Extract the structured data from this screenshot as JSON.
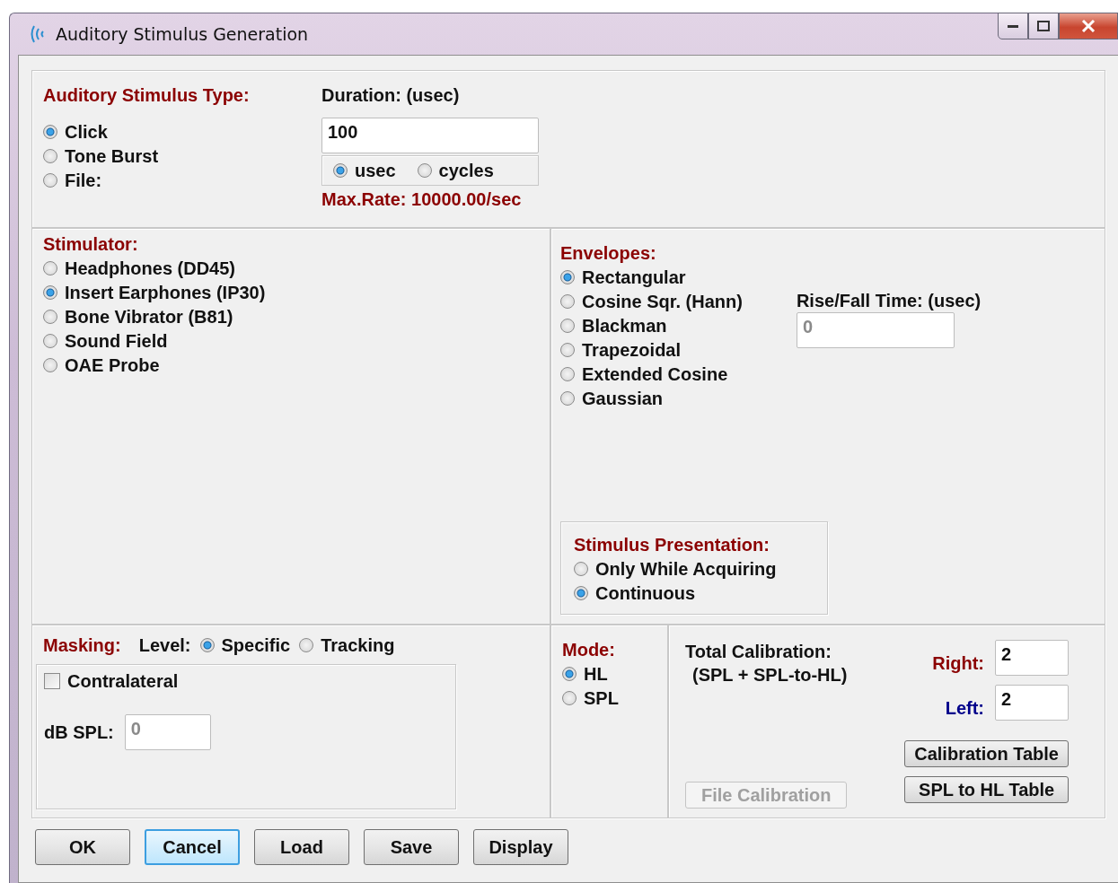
{
  "window": {
    "title": "Auditory Stimulus Generation"
  },
  "stimulus_type": {
    "label": "Auditory Stimulus Type:",
    "options": [
      {
        "label": "Click",
        "selected": true
      },
      {
        "label": "Tone Burst",
        "selected": false
      },
      {
        "label": "File:",
        "selected": false
      }
    ]
  },
  "duration": {
    "label": "Duration: (usec)",
    "value": "100",
    "units": [
      {
        "label": "usec",
        "selected": true
      },
      {
        "label": "cycles",
        "selected": false
      }
    ],
    "max_rate": "Max.Rate: 10000.00/sec"
  },
  "stimulator": {
    "label": "Stimulator:",
    "options": [
      {
        "label": "Headphones (DD45)",
        "selected": false
      },
      {
        "label": "Insert Earphones (IP30)",
        "selected": true
      },
      {
        "label": "Bone Vibrator (B81)",
        "selected": false
      },
      {
        "label": "Sound Field",
        "selected": false
      },
      {
        "label": "OAE Probe",
        "selected": false
      }
    ]
  },
  "envelopes": {
    "label": "Envelopes:",
    "options": [
      {
        "label": "Rectangular",
        "selected": true
      },
      {
        "label": "Cosine Sqr. (Hann)",
        "selected": false
      },
      {
        "label": "Blackman",
        "selected": false
      },
      {
        "label": "Trapezoidal",
        "selected": false
      },
      {
        "label": "Extended Cosine",
        "selected": false
      },
      {
        "label": "Gaussian",
        "selected": false
      }
    ],
    "rise_fall": {
      "label": "Rise/Fall Time: (usec)",
      "value": "0",
      "disabled": true
    }
  },
  "presentation": {
    "label": "Stimulus Presentation:",
    "options": [
      {
        "label": "Only While Acquiring",
        "selected": false
      },
      {
        "label": "Continuous",
        "selected": true
      }
    ]
  },
  "masking": {
    "label": "Masking:",
    "level_label": "Level:",
    "level_options": [
      {
        "label": "Specific",
        "selected": true
      },
      {
        "label": "Tracking",
        "selected": false
      }
    ],
    "contralateral": {
      "label": "Contralateral",
      "checked": false
    },
    "db_spl": {
      "label": "dB SPL:",
      "value": "0",
      "disabled": true
    }
  },
  "mode": {
    "label": "Mode:",
    "options": [
      {
        "label": "HL",
        "selected": true
      },
      {
        "label": "SPL",
        "selected": false
      }
    ]
  },
  "calibration": {
    "label": "Total Calibration:",
    "sublabel": "(SPL + SPL-to-HL)",
    "right": {
      "label": "Right:",
      "value": "2"
    },
    "left": {
      "label": "Left:",
      "value": "2"
    },
    "file_button": {
      "label": "File Calibration",
      "disabled": true
    },
    "table_buttons": [
      {
        "label": "Calibration Table",
        "disabled": false
      },
      {
        "label": "SPL to HL Table",
        "disabled": false
      }
    ]
  },
  "buttons": [
    {
      "label": "OK",
      "focused": false
    },
    {
      "label": "Cancel",
      "focused": true
    },
    {
      "label": "Load",
      "focused": false
    },
    {
      "label": "Save",
      "focused": false
    },
    {
      "label": "Display",
      "focused": false
    }
  ]
}
